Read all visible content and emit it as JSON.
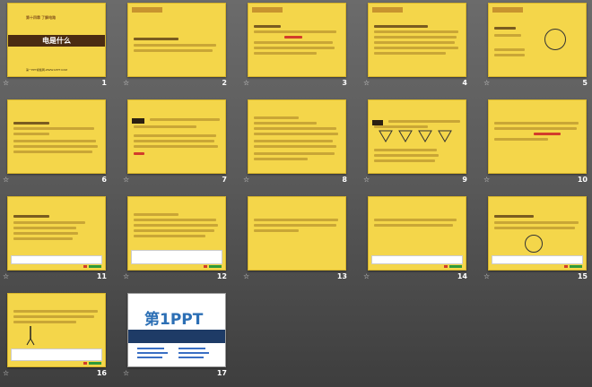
{
  "slide_sorter": {
    "slides": [
      {
        "number": "1",
        "chapter": "第十四章 了解电路",
        "title": "电是什么",
        "link": "第一PPT模板网-WWW.1PPT.COM"
      },
      {
        "number": "2"
      },
      {
        "number": "3"
      },
      {
        "number": "4"
      },
      {
        "number": "5"
      },
      {
        "number": "6"
      },
      {
        "number": "7"
      },
      {
        "number": "8"
      },
      {
        "number": "9"
      },
      {
        "number": "10"
      },
      {
        "number": "11"
      },
      {
        "number": "12"
      },
      {
        "number": "13"
      },
      {
        "number": "14"
      },
      {
        "number": "15"
      },
      {
        "number": "16"
      },
      {
        "number": "17",
        "logo": "第1PPT"
      }
    ],
    "transition_icon": "☆"
  },
  "colors": {
    "slide_background": "#f4d64a",
    "title_band": "#4b2c12",
    "app_background": "#5a5a5a",
    "slide_number": "#ffffff"
  }
}
